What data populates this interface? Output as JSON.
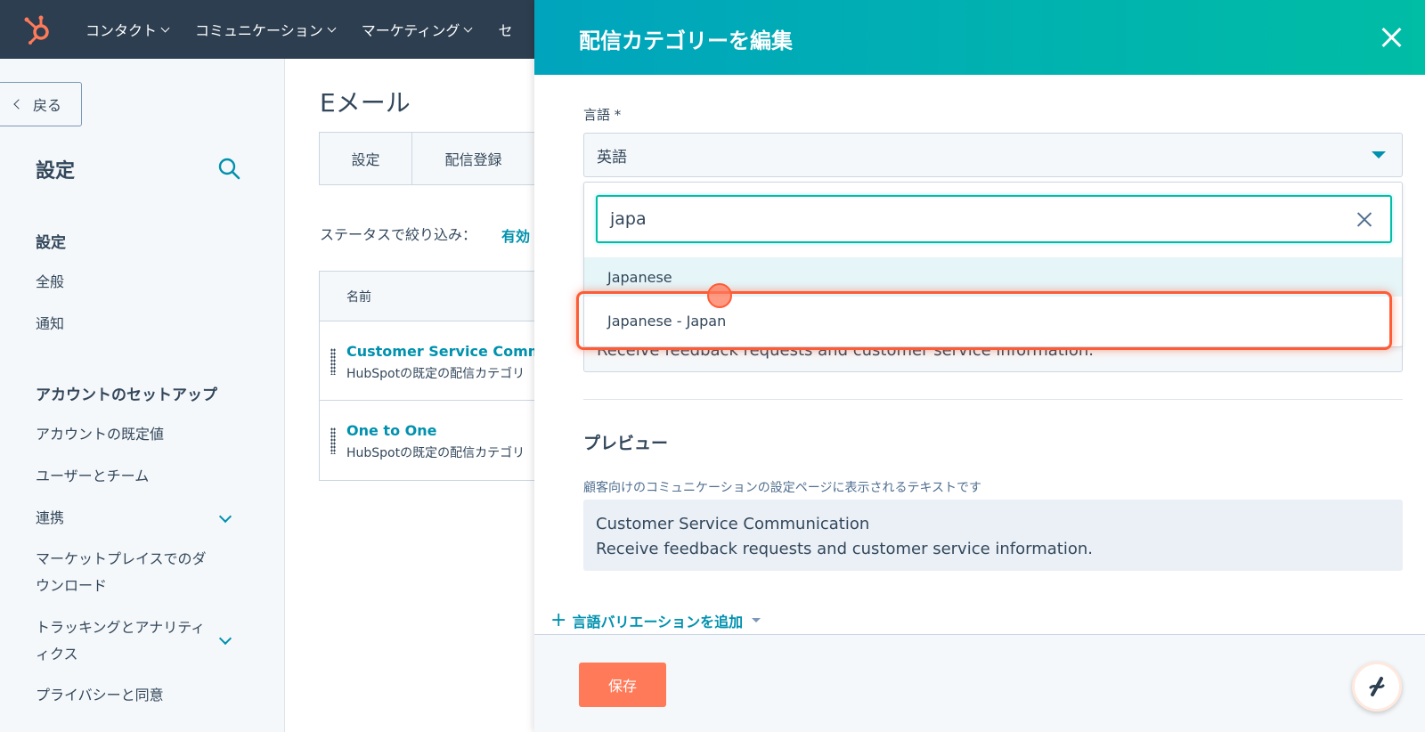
{
  "topnav": {
    "items": [
      "コンタクト",
      "コミュニケーション",
      "マーケティング",
      "セ"
    ]
  },
  "sidebar": {
    "back_label": "戻る",
    "title": "設定",
    "section_settings": "設定",
    "links_settings": [
      "全般",
      "通知"
    ],
    "section_account": "アカウントのセットアップ",
    "links_account": [
      "アカウントの既定値",
      "ユーザーとチーム",
      "連携",
      "マーケットプレイスでのダ",
      "ウンロード",
      "トラッキングとアナリティ",
      "ィクス",
      "プライバシーと同意"
    ]
  },
  "main": {
    "title": "Eメール",
    "tabs": [
      "設定",
      "配信登録"
    ],
    "filter_label": "ステータスで絞り込み：",
    "filter_value": "有効",
    "table_header": "名前",
    "rows": [
      {
        "name": "Customer Service Comm",
        "desc": "HubSpotの既定の配信カテゴリ"
      },
      {
        "name": "One to One",
        "desc": "HubSpotの既定の配信カテゴリ"
      }
    ]
  },
  "panel": {
    "title": "配信カテゴリーを編集",
    "language_label": "言語 *",
    "language_value": "英語",
    "search_value": "japa",
    "options": [
      "Japanese",
      "Japanese - Japan"
    ],
    "hidden_desc": "Receive feedback requests and customer service information.",
    "preview_title": "プレビュー",
    "preview_sub": "顧客向けのコミュニケーションの設定ページに表示されるテキストです",
    "preview_line1": "Customer Service Communication",
    "preview_line2": "Receive feedback requests and customer service information.",
    "add_language": "言語バリエーションを追加",
    "save_label": "保存"
  },
  "colors": {
    "nav_bg": "#2d3e50",
    "accent": "#0091ae",
    "header_gradient_start": "#00a4bd",
    "header_gradient_end": "#00bda5",
    "save_button": "#ff7a59",
    "highlight": "#ff5c35"
  }
}
